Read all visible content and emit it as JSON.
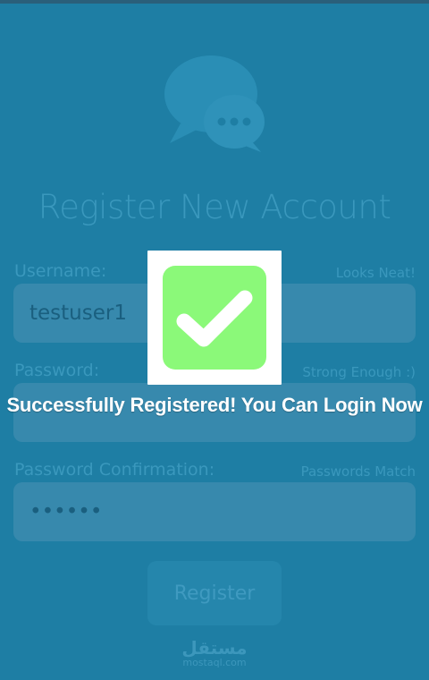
{
  "app": {
    "heading": "Register New Account"
  },
  "form": {
    "username": {
      "label": "Username:",
      "value": "testuser1",
      "status": "Looks Neat!"
    },
    "password": {
      "label": "Password:",
      "value": "",
      "status": "Strong Enough :)"
    },
    "confirm": {
      "label": "Password Confirmation:",
      "value": "••••••",
      "status": "Passwords Match"
    },
    "register_label": "Register"
  },
  "toast": {
    "icon": "checkmark-icon",
    "message": "Successfully Registered! You Can Login Now"
  },
  "watermark": {
    "arabic": "مستقل",
    "latin": "mostaql.com"
  },
  "colors": {
    "background": "#1e7ea4",
    "field": "#3789ad",
    "success_green": "#8bf979",
    "toast_text": "#ffffff"
  }
}
